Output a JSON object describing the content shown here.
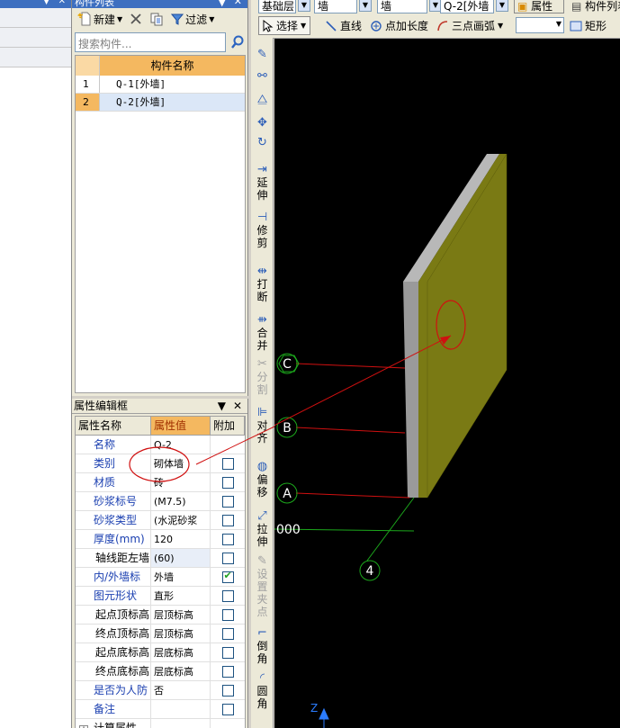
{
  "component_panel": {
    "title": "构件列表",
    "new_label": "新建",
    "filter_label": "过滤",
    "search_placeholder": "搜索构件...",
    "column_header": "构件名称",
    "rows": [
      {
        "num": "1",
        "name": "Q-1[外墙]"
      },
      {
        "num": "2",
        "name": "Q-2[外墙]"
      }
    ]
  },
  "property_panel": {
    "title": "属性编辑框",
    "headers": {
      "name": "属性名称",
      "value": "属性值",
      "add": "附加"
    },
    "rows": [
      {
        "name": "名称",
        "value": "Q-2",
        "checked": null
      },
      {
        "name": "类别",
        "value": "砌体墙",
        "checked": false
      },
      {
        "name": "材质",
        "value": "砖",
        "checked": false
      },
      {
        "name": "砂浆标号",
        "value": "(M7.5)",
        "checked": false
      },
      {
        "name": "砂浆类型",
        "value": "(水泥砂浆",
        "checked": false
      },
      {
        "name": "厚度(mm)",
        "value": "120",
        "checked": false
      },
      {
        "name": "轴线距左墙",
        "value": "(60)",
        "checked": false
      },
      {
        "name": "内/外墙标",
        "value": "外墙",
        "checked": true
      },
      {
        "name": "图元形状",
        "value": "直形",
        "checked": false
      },
      {
        "name": "起点顶标高",
        "value": "层顶标高",
        "checked": false
      },
      {
        "name": "终点顶标高",
        "value": "层顶标高",
        "checked": false
      },
      {
        "name": "起点底标高",
        "value": "层底标高",
        "checked": false
      },
      {
        "name": "终点底标高",
        "value": "层底标高",
        "checked": false
      },
      {
        "name": "是否为人防",
        "value": "否",
        "checked": false
      },
      {
        "name": "备注",
        "value": "",
        "checked": false
      },
      {
        "name": "计算属性",
        "value": "",
        "checked": null
      }
    ]
  },
  "top_toolbar": {
    "floor": "基础层",
    "type1": "墙",
    "type2": "墙",
    "component": "Q-2[外墙",
    "properties_label": "属性",
    "list_label": "构件列表",
    "select_label": "选择",
    "line_label": "直线",
    "point_length_label": "点加长度",
    "arc_label": "三点画弧",
    "rect_label": "矩形"
  },
  "vertical_toolbar": [
    {
      "label": "延伸",
      "icon": "extend-icon",
      "enabled": true
    },
    {
      "label": "修剪",
      "icon": "trim-icon",
      "enabled": true
    },
    {
      "label": "打断",
      "icon": "break-icon",
      "enabled": true
    },
    {
      "label": "合并",
      "icon": "merge-icon",
      "enabled": true
    },
    {
      "label": "分割",
      "icon": "split-icon",
      "enabled": false
    },
    {
      "label": "对齐",
      "icon": "align-icon",
      "enabled": true
    },
    {
      "label": "偏移",
      "icon": "offset-icon",
      "enabled": true
    },
    {
      "label": "拉伸",
      "icon": "stretch-icon",
      "enabled": true
    },
    {
      "label": "设置夹点",
      "icon": "grip-icon",
      "enabled": false
    },
    {
      "label": "倒角",
      "icon": "chamfer-icon",
      "enabled": true
    },
    {
      "label": "圆角",
      "icon": "fillet-icon",
      "enabled": true
    }
  ],
  "canvas": {
    "axes": [
      "C",
      "B",
      "A",
      "4"
    ],
    "dimension_text": "000",
    "z_label": "Z",
    "wall_color": "#7a7a14",
    "wall_side_color": "#9a9a9a",
    "annotation_color": "#d01010"
  }
}
